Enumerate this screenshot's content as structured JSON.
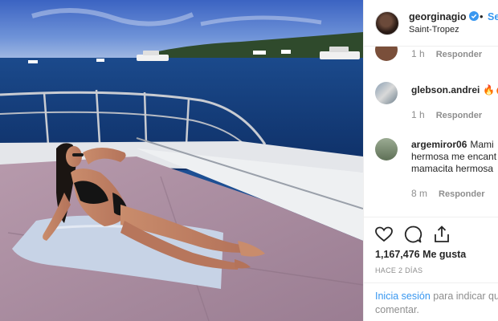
{
  "post": {
    "username": "georginagio",
    "follow_dot": "•",
    "follow_label": "Se",
    "location": "Saint-Tropez"
  },
  "comments": [
    {
      "user": "",
      "text": "",
      "time": "1 h",
      "reply": "Responder"
    },
    {
      "user": "glebson.andrei",
      "text": "🔥🔥",
      "time": "1 h",
      "reply": "Responder"
    },
    {
      "user": "argemiror06",
      "line1": "Mami",
      "line2": "hermosa me encant",
      "line3": "mamacita hermosa",
      "time": "8 m",
      "reply": "Responder"
    }
  ],
  "stats": {
    "likes": "1,167,476 Me gusta",
    "time_ago": "HACE 2 DÍAS"
  },
  "login": {
    "link": "Inicia sesión",
    "rest": " para indicar qu",
    "line2": "comentar."
  },
  "icons": {
    "like": "heart-icon",
    "comment": "comment-bubble-icon",
    "share": "share-icon",
    "verified": "verified-badge-icon"
  },
  "colors": {
    "link": "#3897f0",
    "muted": "#8e8e8e",
    "text": "#262626",
    "sea": "#1d4f93",
    "deck": "#a3879b"
  }
}
